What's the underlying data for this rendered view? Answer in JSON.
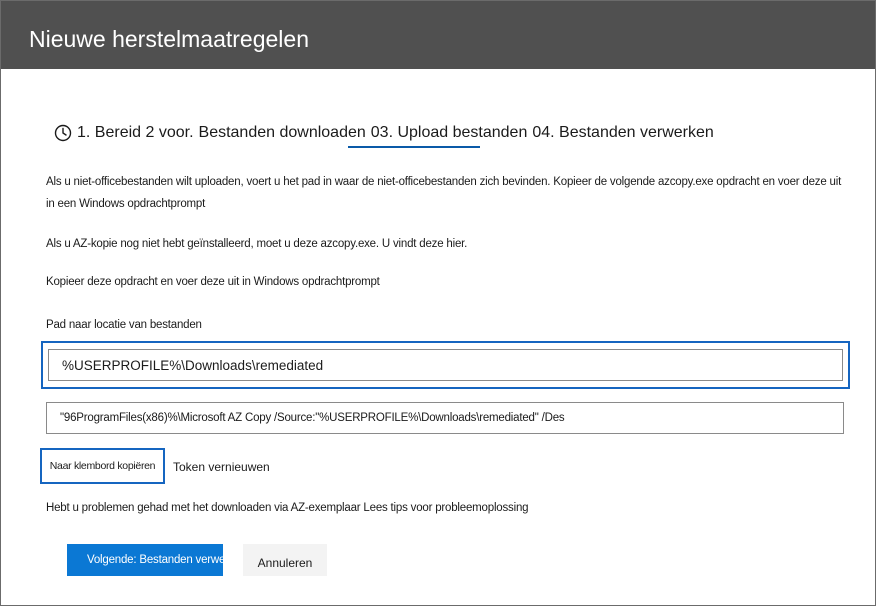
{
  "header": {
    "title": "Nieuwe herstelmaatregelen"
  },
  "steps": {
    "icon": "clock-icon",
    "step1": "1. Bereid 2 voor.",
    "step2": "Bestanden downloaden",
    "step3": "03. Upload bestanden",
    "step4": "04. Bestanden verwerken",
    "active_color": "#0a5aa8"
  },
  "content": {
    "para1": "Als u niet-officebestanden wilt uploaden, voert u het pad in waar de niet-officebestanden zich bevinden. Kopieer de volgende azcopy.exe opdracht en voer deze uit in een Windows opdrachtprompt",
    "para2": "Als u AZ-kopie nog niet hebt geïnstalleerd, moet u deze azcopy.exe. U vindt deze hier.",
    "para3": "Kopieer deze opdracht en voer deze uit in Windows opdrachtprompt",
    "path_label": "Pad naar locatie van bestanden",
    "path_value": "%USERPROFILE%\\Downloads\\remediated",
    "command_value": "\"96ProgramFiles(x86)%\\Microsoft AZ Copy /Source:\"%USERPROFILE%\\Downloads\\remediated\" /Des",
    "help_text": "Hebt u problemen gehad met het downloaden via AZ-exemplaar Lees tips voor probleemoplossing"
  },
  "actions": {
    "copy_label": "Naar klembord kopiëren",
    "refresh_label": "Token vernieuwen",
    "next_label": "Volgende: Bestanden verwerken",
    "cancel_label": "Annuleren"
  },
  "colors": {
    "header_bg": "#505050",
    "accent": "#0b78d4",
    "highlight_border": "#1565c0"
  }
}
